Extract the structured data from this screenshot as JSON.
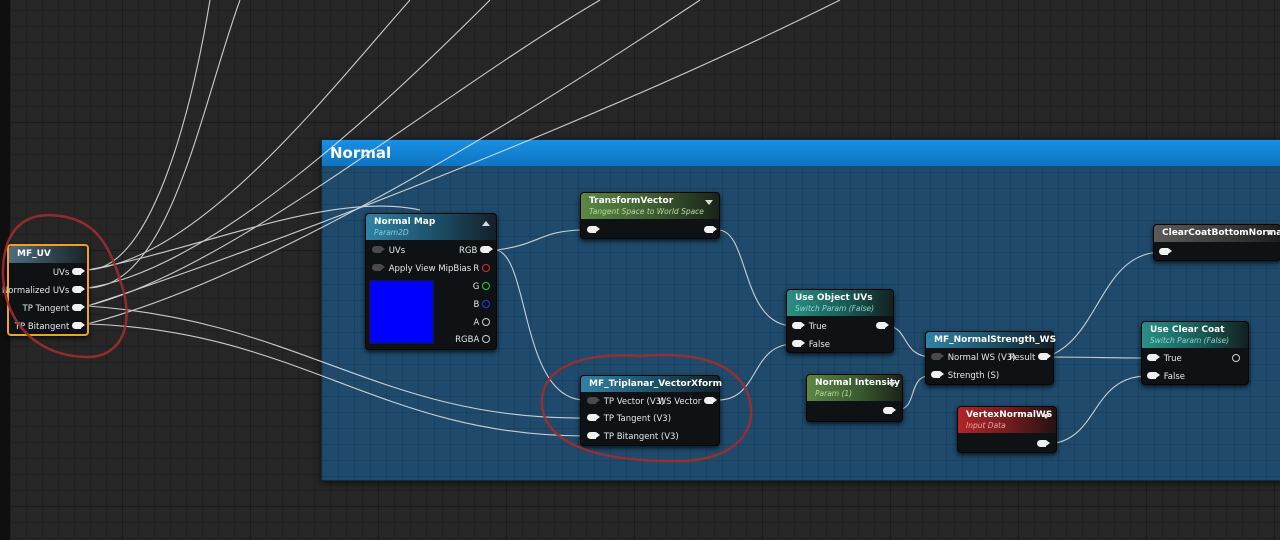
{
  "comment": {
    "title": "Normal"
  },
  "colors": {
    "comment_header": "#1a8fe0",
    "comment_body": "#1f4a6b",
    "wire": "#e8e8e8",
    "selection_outline": "#f1a21c",
    "annotation_circle": "#9e2d2d",
    "preview_color": "#0000ff"
  },
  "nodes": {
    "mf_uv": {
      "title": "MF_UV",
      "outputs": [
        "UVs",
        "Normalized UVs",
        "TP Tangent",
        "TP Bitangent"
      ]
    },
    "normal_map": {
      "title": "Normal Map",
      "subtitle": "Param2D",
      "inputs": [
        "UVs",
        "Apply View MipBias"
      ],
      "outputs": [
        "RGB",
        "R",
        "G",
        "B",
        "A",
        "RGBA"
      ]
    },
    "transform_vector": {
      "title": "TransformVector",
      "subtitle": "Tangent Space to World Space"
    },
    "mf_triplanar": {
      "title": "MF_Triplanar_VectorXform",
      "inputs": [
        "TP Vector (V3)",
        "TP Tangent (V3)",
        "TP Bitangent (V3)"
      ],
      "output": "WS Vector"
    },
    "use_object_uvs": {
      "title": "Use Object UVs",
      "subtitle": "Switch Param (False)",
      "inputs": [
        "True",
        "False"
      ]
    },
    "normal_intensity": {
      "title": "Normal Intensity",
      "subtitle": "Param (1)"
    },
    "mf_normal_strength": {
      "title": "MF_NormalStrength_WS",
      "inputs": [
        "Normal WS (V3)",
        "Strength (S)"
      ],
      "output": "Result"
    },
    "vertex_normal_ws": {
      "title": "VertexNormalWS",
      "subtitle": "Input Data"
    },
    "clear_coat_bottom_normal": {
      "title": "ClearCoatBottomNormal"
    },
    "use_clear_coat": {
      "title": "Use Clear Coat",
      "subtitle": "Switch Param (False)",
      "inputs": [
        "True",
        "False"
      ]
    }
  }
}
